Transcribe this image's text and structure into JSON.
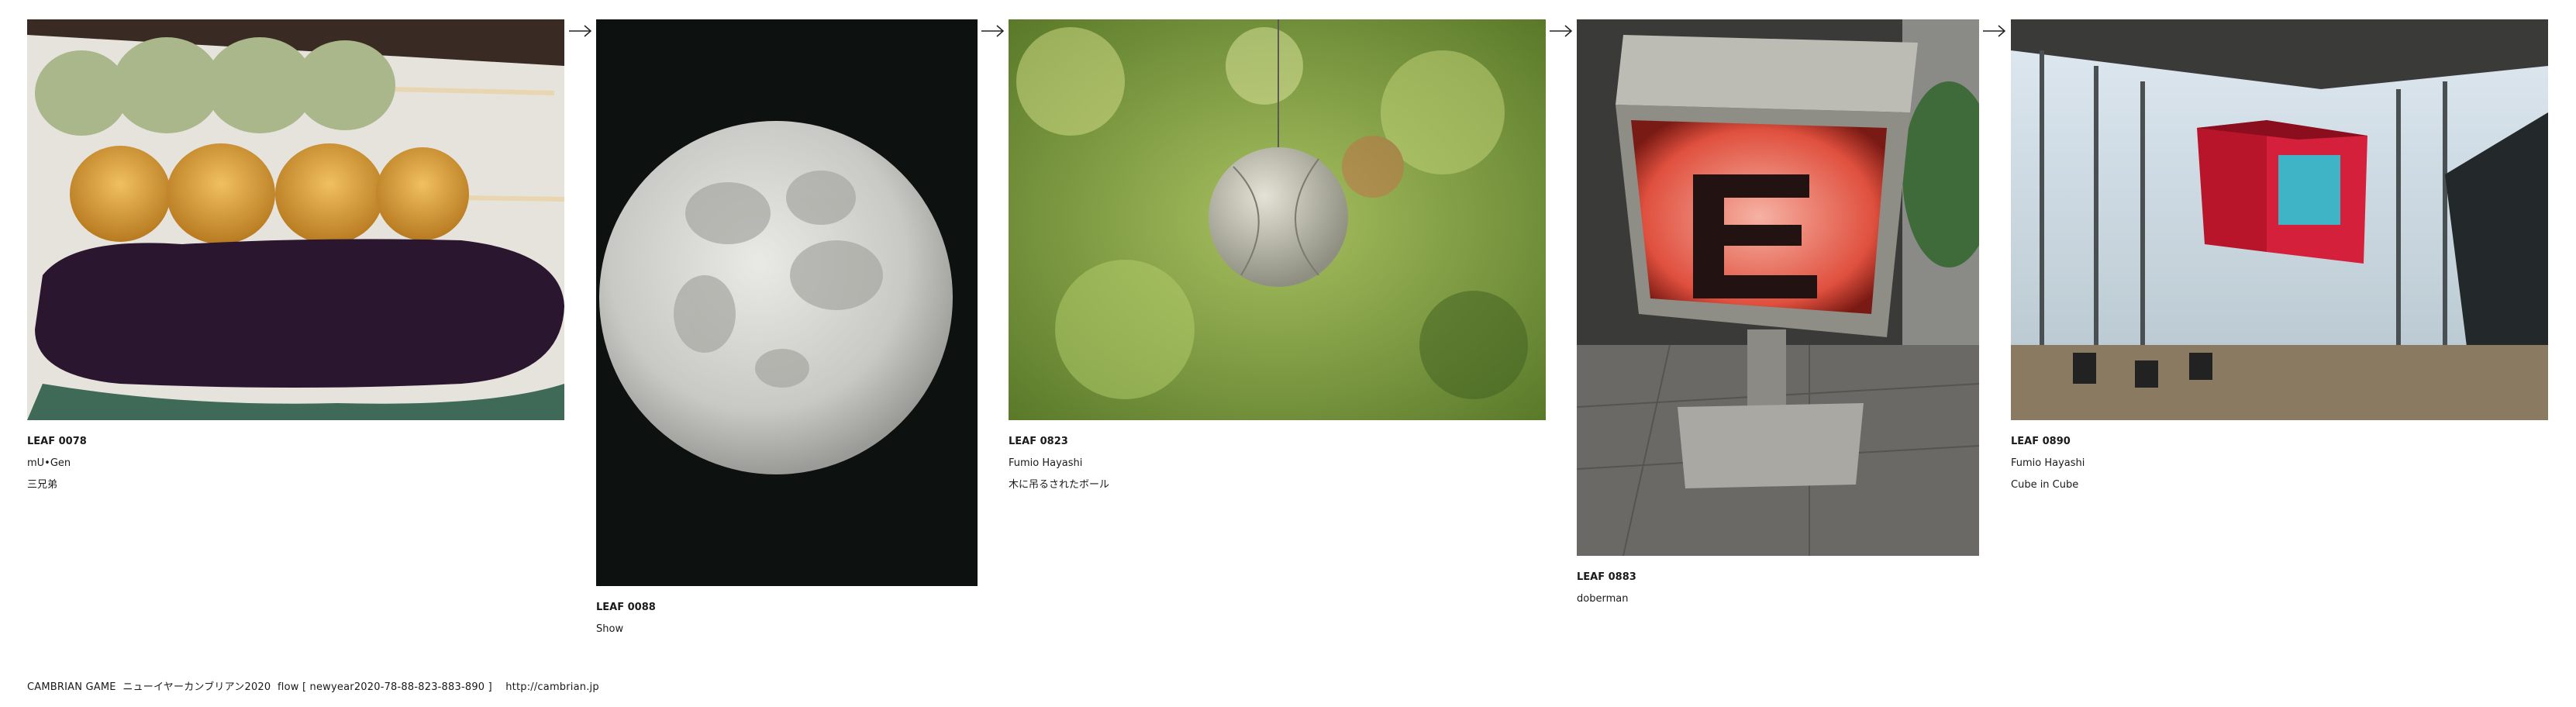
{
  "leaves": [
    {
      "code": "LEAF 0078",
      "author": "mU•Gen",
      "title": "三兄弟",
      "image": "dango-skewers-photo"
    },
    {
      "code": "LEAF 0088",
      "title": "Show",
      "image": "full-moon-photo"
    },
    {
      "code": "LEAF 0823",
      "author": "Fumio Hayashi",
      "title": "木に吊るされたボール",
      "image": "hanging-ball-photo"
    },
    {
      "code": "LEAF 0883",
      "title": "doberman",
      "image": "lit-cube-sign-photo"
    },
    {
      "code": "LEAF 0890",
      "author": "Fumio Hayashi",
      "title": "Cube in Cube",
      "image": "atrium-cube-photo"
    }
  ],
  "arrow_icon": "right-arrow-icon",
  "footer": {
    "text": "CAMBRIAN GAME  ニューイヤーカンブリアン2020  flow [ newyear2020-78-88-823-883-890 ]    http://cambrian.jp"
  }
}
